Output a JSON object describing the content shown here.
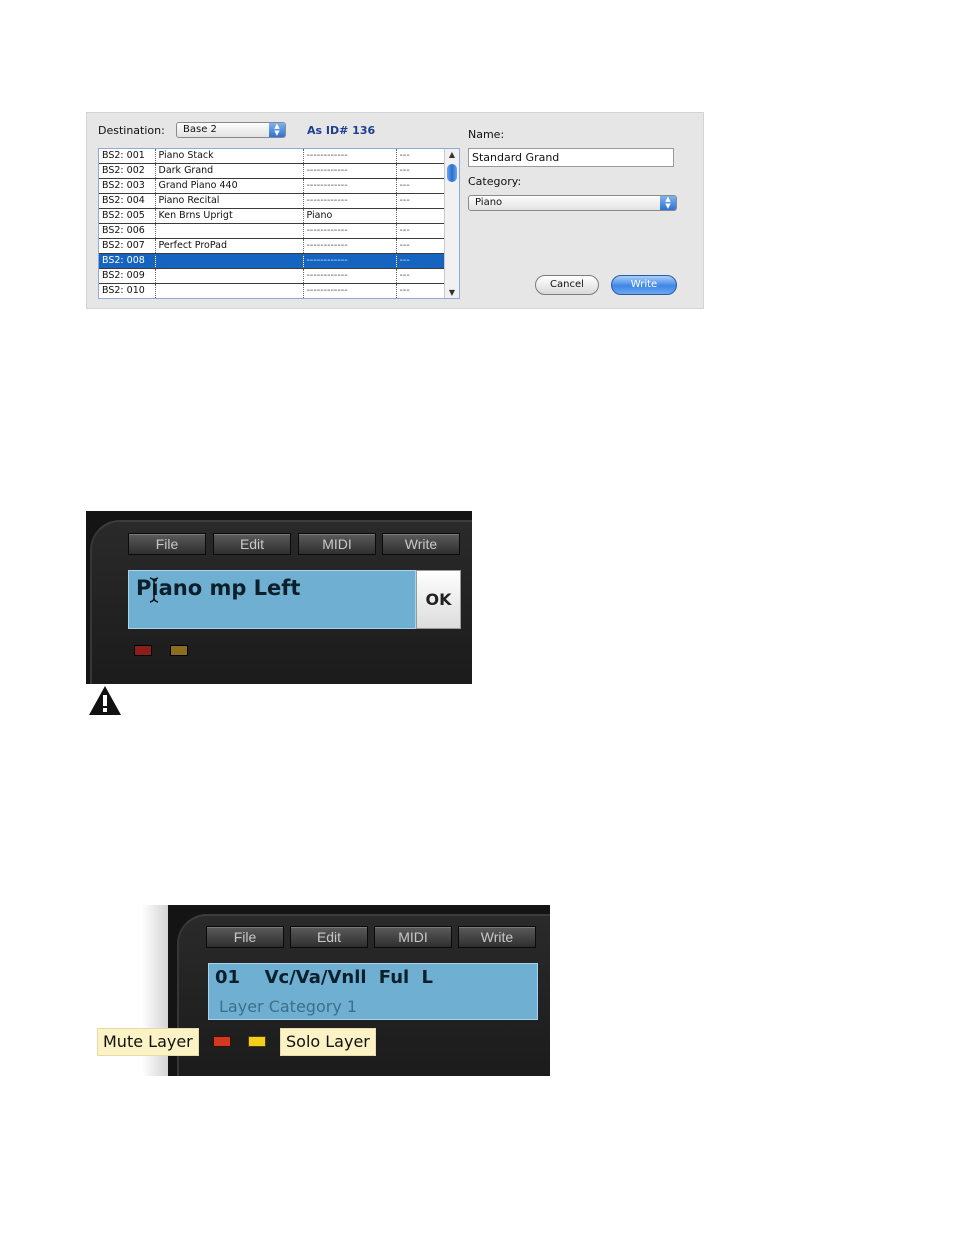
{
  "write_dialog": {
    "destination_label": "Destination:",
    "destination_value": "Base 2",
    "as_id": "As ID# 136",
    "name_label": "Name:",
    "name_value": "Standard Grand",
    "category_label": "Category:",
    "category_value": "Piano",
    "cancel_label": "Cancel",
    "write_label": "Write",
    "rows": [
      {
        "slot": "BS2: 001",
        "name": "Piano Stack",
        "category": "------------",
        "flag": "---"
      },
      {
        "slot": "BS2: 002",
        "name": "Dark Grand",
        "category": "------------",
        "flag": "---"
      },
      {
        "slot": "BS2: 003",
        "name": "Grand Piano 440",
        "category": "------------",
        "flag": "---"
      },
      {
        "slot": "BS2: 004",
        "name": "Piano Recital",
        "category": "------------",
        "flag": "---"
      },
      {
        "slot": "BS2: 005",
        "name": "Ken Brns Uprigt",
        "category": "Piano",
        "flag": ""
      },
      {
        "slot": "BS2: 006",
        "name": "",
        "category": "------------",
        "flag": "---"
      },
      {
        "slot": "BS2: 007",
        "name": "Perfect ProPad",
        "category": "------------",
        "flag": "---"
      },
      {
        "slot": "BS2: 008",
        "name": "",
        "category": "------------",
        "flag": "---",
        "selected": true
      },
      {
        "slot": "BS2: 009",
        "name": "",
        "category": "------------",
        "flag": "---"
      },
      {
        "slot": "BS2: 010",
        "name": "",
        "category": "------------",
        "flag": "---"
      }
    ]
  },
  "panel1": {
    "menu": [
      "File",
      "Edit",
      "MIDI",
      "Write"
    ],
    "lcd_text": "Piano mp Left",
    "ok_label": "OK"
  },
  "panel2": {
    "menu": [
      "File",
      "Edit",
      "MIDI",
      "Write"
    ],
    "layer_number": "01",
    "layer_name": "Vc/Va/Vnll Ful L",
    "layer_category": "Layer Category 1",
    "mute_tooltip": "Mute Layer",
    "solo_tooltip": "Solo Layer"
  },
  "colors": {
    "lcd_blue": "#6fb0d2",
    "selection_blue": "#1565c0",
    "mute_led": "#d2391f",
    "solo_led": "#f1cf1c",
    "tooltip_bg": "#fbf3c5"
  },
  "icons": [
    "popup-arrows-icon",
    "scroll-up-icon",
    "scroll-down-icon",
    "text-cursor-icon",
    "warning-icon"
  ]
}
